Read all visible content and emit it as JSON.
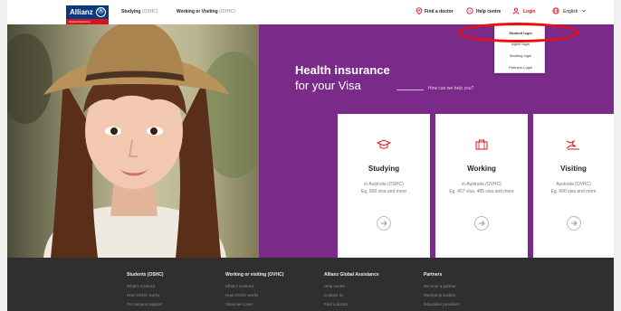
{
  "header": {
    "logo_text": "Allianz",
    "logo_sub": "Global Assistance",
    "nav": [
      {
        "label": "Studying",
        "suffix": "(OSHC)"
      },
      {
        "label": "Working or Visiting",
        "suffix": "(OVHC)"
      }
    ],
    "find_doctor": "Find a doctor",
    "help_centre": "Help centre",
    "login": "Login",
    "language": "English"
  },
  "login_menu": [
    "Student login",
    "Agent login",
    "Working login",
    "Partners Login"
  ],
  "hero": {
    "title": "Health insurance",
    "subtitle": "for your Visa",
    "help_prompt": "How can we help you?"
  },
  "cards": [
    {
      "title": "Studying",
      "line1": "in Australia (OSHC)",
      "line2": "Eg. 500 visa and more",
      "icon": "graduation-cap-icon"
    },
    {
      "title": "Working",
      "line1": "in Australia (OVHC)",
      "line2": "Eg. 457 visa, 485 visa and more",
      "icon": "briefcase-icon"
    },
    {
      "title": "Visiting",
      "line1": "Australia (OVHC)",
      "line2": "Eg. 600 visa and more",
      "icon": "travel-icon"
    }
  ],
  "footer": {
    "columns": [
      {
        "heading": "Students (OSHC)",
        "links": [
          "What's covered",
          "How OSHC works",
          "On campus support"
        ]
      },
      {
        "heading": "Working or visiting (OVHC)",
        "links": [
          "What's covered",
          "How OVHC works",
          "Visas we cover"
        ]
      },
      {
        "heading": "Allianz Global Assistance",
        "links": [
          "Help centre",
          "Contact us",
          "Find a doctor"
        ]
      },
      {
        "heading": "Partners",
        "links": [
          "Become a partner",
          "Medical providers",
          "Education providers"
        ]
      }
    ]
  },
  "colors": {
    "brand_blue": "#0a3a7e",
    "accent_red": "#d8141e",
    "hero_purple": "#7a2b8a",
    "footer_bg": "#2f2f2f",
    "annotation_red": "#ea0f0f"
  }
}
